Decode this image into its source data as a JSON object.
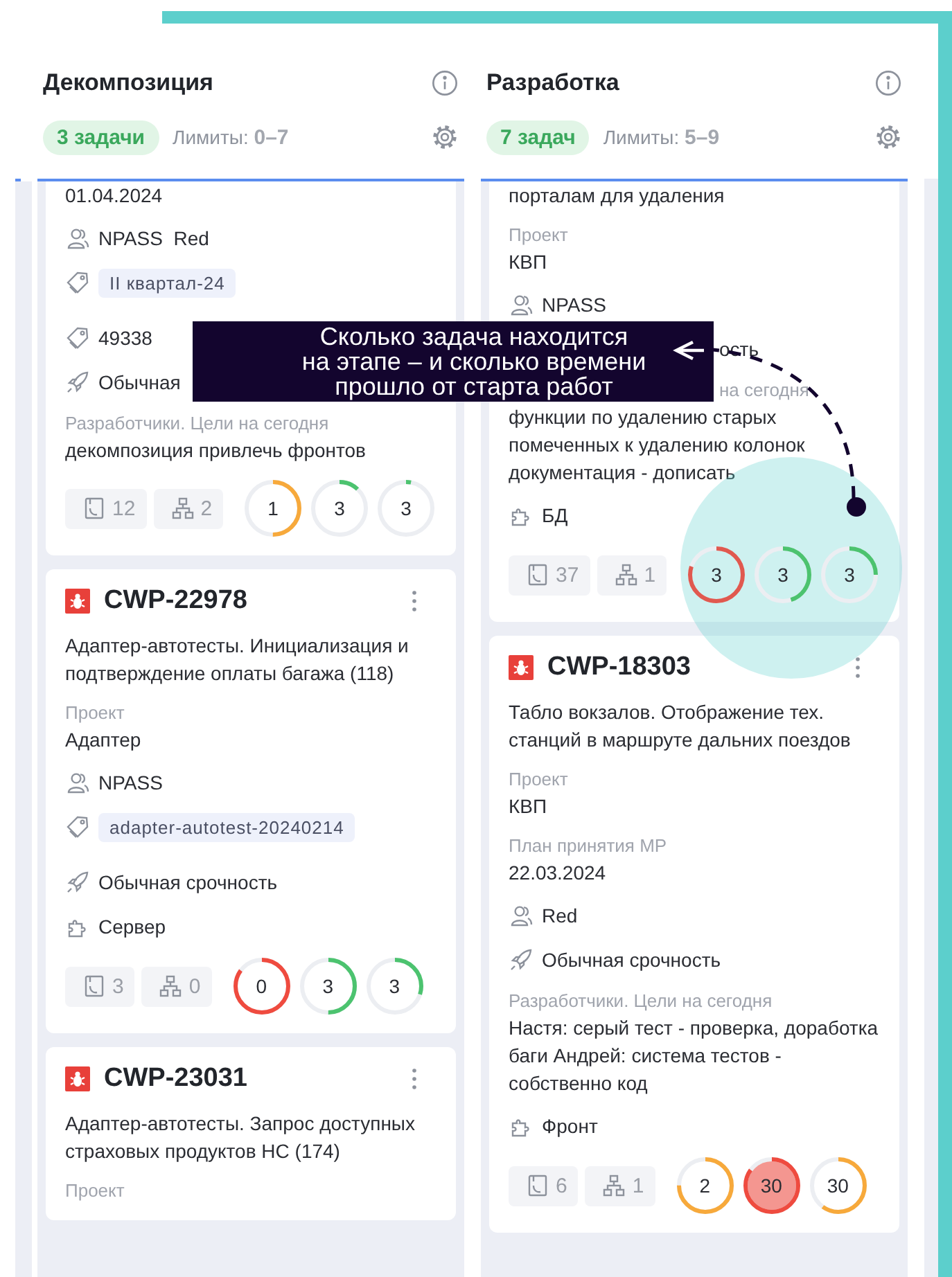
{
  "callout": {
    "text": "Сколько задача находится\nна этапе  – и сколько времени\nпрошло от старта работ"
  },
  "columns": [
    {
      "title": "Декомпозиция",
      "count": "3 задачи",
      "limits_label": "Лимиты:",
      "limits": "0–7",
      "cards": [
        {
          "rows": [
            {
              "kind": "value",
              "text": "01.04.2024"
            },
            {
              "kind": "people",
              "text": "NPASS  Red"
            },
            {
              "kind": "label_tag",
              "text": "II квартал-24"
            },
            {
              "kind": "tag",
              "text": "49338"
            },
            {
              "kind": "urgency",
              "text": "Обычная"
            },
            {
              "kind": "field",
              "label": "Разработчики. Цели на сегодня",
              "value": "декомпозиция привлечь фронтов"
            }
          ],
          "files": "12",
          "subtasks": "2",
          "rings": [
            {
              "value": "1",
              "color": "#f7a93b",
              "level": 0.5,
              "filled": false
            },
            {
              "value": "3",
              "color": "#4cc36f",
              "level": 0.12,
              "filled": false
            },
            {
              "value": "3",
              "color": "#4cc36f",
              "level": 0.03,
              "filled": false
            }
          ]
        },
        {
          "id": "CWP-22978",
          "description": "Адаптер-автотесты. Инициализация и подтверждение оплаты багажа (118)",
          "rows": [
            {
              "kind": "field",
              "label": "Проект",
              "value": "Адаптер"
            },
            {
              "kind": "people",
              "text": "NPASS"
            },
            {
              "kind": "label_tag",
              "text": "adapter-autotest-20240214"
            },
            {
              "kind": "urgency",
              "text": "Обычная срочность"
            },
            {
              "kind": "component",
              "text": "Сервер"
            }
          ],
          "files": "3",
          "subtasks": "0",
          "rings": [
            {
              "value": "0",
              "color": "#ef4b3f",
              "level": 0.85,
              "filled": false
            },
            {
              "value": "3",
              "color": "#4cc36f",
              "level": 0.5,
              "filled": false
            },
            {
              "value": "3",
              "color": "#4cc36f",
              "level": 0.3,
              "filled": false
            }
          ]
        },
        {
          "id": "CWP-23031",
          "description": "Адаптер-автотесты. Запрос доступных страховых продуктов НС (174)",
          "rows": [
            {
              "kind": "field",
              "label": "Проект"
            }
          ]
        }
      ]
    },
    {
      "title": "Разработка",
      "count": "7 задач",
      "limits_label": "Лимиты:",
      "limits": "5–9",
      "cards": [
        {
          "rows": [
            {
              "kind": "value",
              "text": "порталам для удаления"
            },
            {
              "kind": "field",
              "label": "Проект",
              "value": "КВП"
            },
            {
              "kind": "people",
              "text": "NPASS"
            },
            {
              "kind": "fragment",
              "text": "ость"
            },
            {
              "kind": "field_partial",
              "label": "на сегодня",
              "value": "функции по удалению старых помеченных к удалению колонок документация - дописать"
            },
            {
              "kind": "component",
              "text": "БД"
            }
          ],
          "files": "37",
          "subtasks": "1",
          "rings": [
            {
              "value": "3",
              "color": "#e0594f",
              "level": 0.8,
              "filled": false
            },
            {
              "value": "3",
              "color": "#4cc36f",
              "level": 0.45,
              "filled": false
            },
            {
              "value": "3",
              "color": "#4cc36f",
              "level": 0.25,
              "filled": false
            }
          ]
        },
        {
          "id": "CWP-18303",
          "description": "Табло вокзалов. Отображение тех. станций в маршруте дальних поездов",
          "rows": [
            {
              "kind": "field",
              "label": "Проект",
              "value": "КВП"
            },
            {
              "kind": "field",
              "label": "План принятия МР",
              "value": "22.03.2024"
            },
            {
              "kind": "people",
              "text": "Red"
            },
            {
              "kind": "urgency",
              "text": "Обычная срочность"
            },
            {
              "kind": "field",
              "label": "Разработчики. Цели на сегодня",
              "value": "Настя: серый тест - проверка, доработка баги Андрей: система тестов - собственно код"
            },
            {
              "kind": "component",
              "text": "Фронт"
            }
          ],
          "files": "6",
          "subtasks": "1",
          "rings": [
            {
              "value": "2",
              "color": "#f7a93b",
              "level": 0.75,
              "filled": false
            },
            {
              "value": "30",
              "color": "#ef4b3f",
              "level": 0.85,
              "filled": true
            },
            {
              "value": "30",
              "color": "#f7a93b",
              "level": 0.6,
              "filled": false
            }
          ]
        }
      ]
    }
  ]
}
